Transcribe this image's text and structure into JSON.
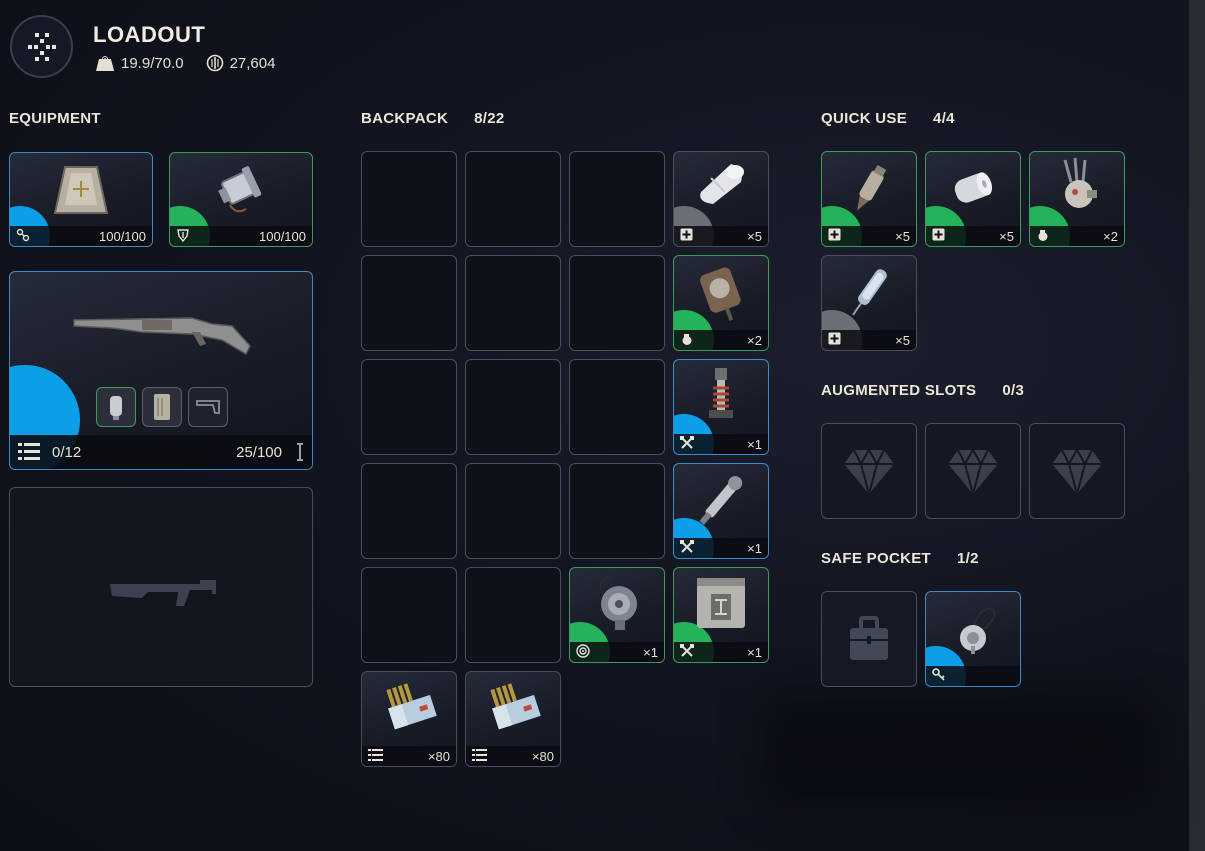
{
  "header": {
    "title": "LOADOUT",
    "weight": "19.9/70.0",
    "currency": "27,604"
  },
  "equipment": {
    "heading": "EQUIPMENT",
    "augment": {
      "durability": "100/100"
    },
    "shield": {
      "durability": "100/100"
    },
    "weapon": {
      "ammo": "0/12",
      "durability": "25/100"
    }
  },
  "backpack": {
    "heading": "BACKPACK",
    "count": "8/22",
    "items": [
      {
        "name": "bandage",
        "qty": "×5",
        "rarity": "gray",
        "tag": "plus-icon"
      },
      {
        "name": "trap",
        "qty": "×2",
        "rarity": "green",
        "tag": "grenade-icon"
      },
      {
        "name": "coil",
        "qty": "×1",
        "rarity": "blue",
        "tag": "tools-icon"
      },
      {
        "name": "scope-part",
        "qty": "×1",
        "rarity": "blue",
        "tag": "tools-icon"
      },
      {
        "name": "scanner",
        "qty": "×1",
        "rarity": "green",
        "tag": "target-icon"
      },
      {
        "name": "crate",
        "qty": "×1",
        "rarity": "green",
        "tag": "tools-icon"
      },
      {
        "name": "ammo-a",
        "qty": "×80",
        "rarity": "none",
        "tag": "ammo-icon"
      },
      {
        "name": "ammo-b",
        "qty": "×80",
        "rarity": "none",
        "tag": "ammo-icon"
      }
    ]
  },
  "quick_use": {
    "heading": "QUICK USE",
    "count": "4/4",
    "items": [
      {
        "qty": "×5",
        "tag": "plus-icon"
      },
      {
        "qty": "×5",
        "tag": "plus-icon"
      },
      {
        "qty": "×2",
        "tag": "grenade-icon"
      },
      {
        "qty": "×5",
        "tag": "plus-icon"
      }
    ]
  },
  "augmented": {
    "heading": "AUGMENTED SLOTS",
    "count": "0/3"
  },
  "safe_pocket": {
    "heading": "SAFE POCKET",
    "count": "1/2"
  },
  "colors": {
    "blue": "#0d9ee8",
    "green": "#24b35a",
    "gray": "#6c6f76"
  }
}
